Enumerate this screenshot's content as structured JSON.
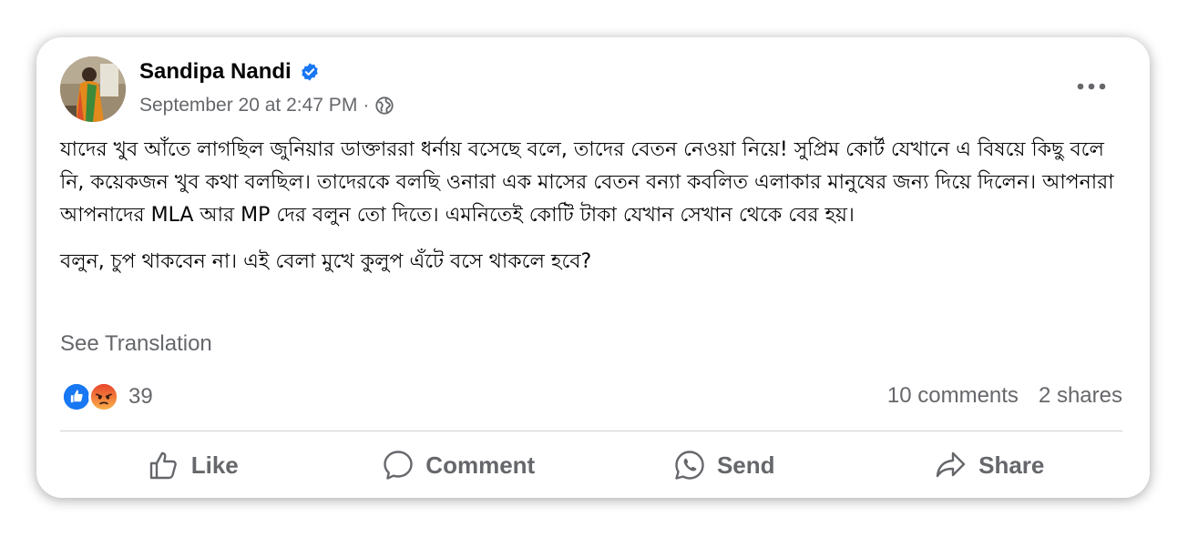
{
  "post": {
    "author": "Sandipa Nandi",
    "timestamp": "September 20 at 2:47 PM",
    "separator": "·",
    "audience_icon": "globe-icon",
    "paragraph_1": "যাদের খুব আঁতে লাগছিল জুনিয়ার ডাক্তাররা ধর্নায় বসেছে বলে, তাদের বেতন নেওয়া নিয়ে! সুপ্রিম কোর্ট যেখানে এ বিষয়ে কিছু বলে নি, কয়েকজন খুব কথা বলছিল। তাদেরকে বলছি ওনারা এক মাসের বেতন বন্যা কবলিত এলাকার মানুষের জন্য দিয়ে দিলেন। আপনারা আপনাদের MLA আর MP দের বলুন তো দিতে। এমনিতেই কোটি টাকা যেখান সেখান থেকে বের হয়।",
    "paragraph_2": "বলুন, চুপ থাকবেন না। এই বেলা মুখে কুলুপ এঁটে বসে থাকলে হবে?",
    "see_translation": "See Translation"
  },
  "engagement": {
    "reaction_icons": [
      "like-reaction-icon",
      "angry-reaction-icon"
    ],
    "reaction_count": "39",
    "comments": "10 comments",
    "shares": "2 shares"
  },
  "actions": {
    "like": "Like",
    "comment": "Comment",
    "send": "Send",
    "share": "Share"
  },
  "colors": {
    "verified": "#1877f2",
    "like": "#1877f2",
    "angry": "#f0604a",
    "secondary_text": "#65676b"
  }
}
